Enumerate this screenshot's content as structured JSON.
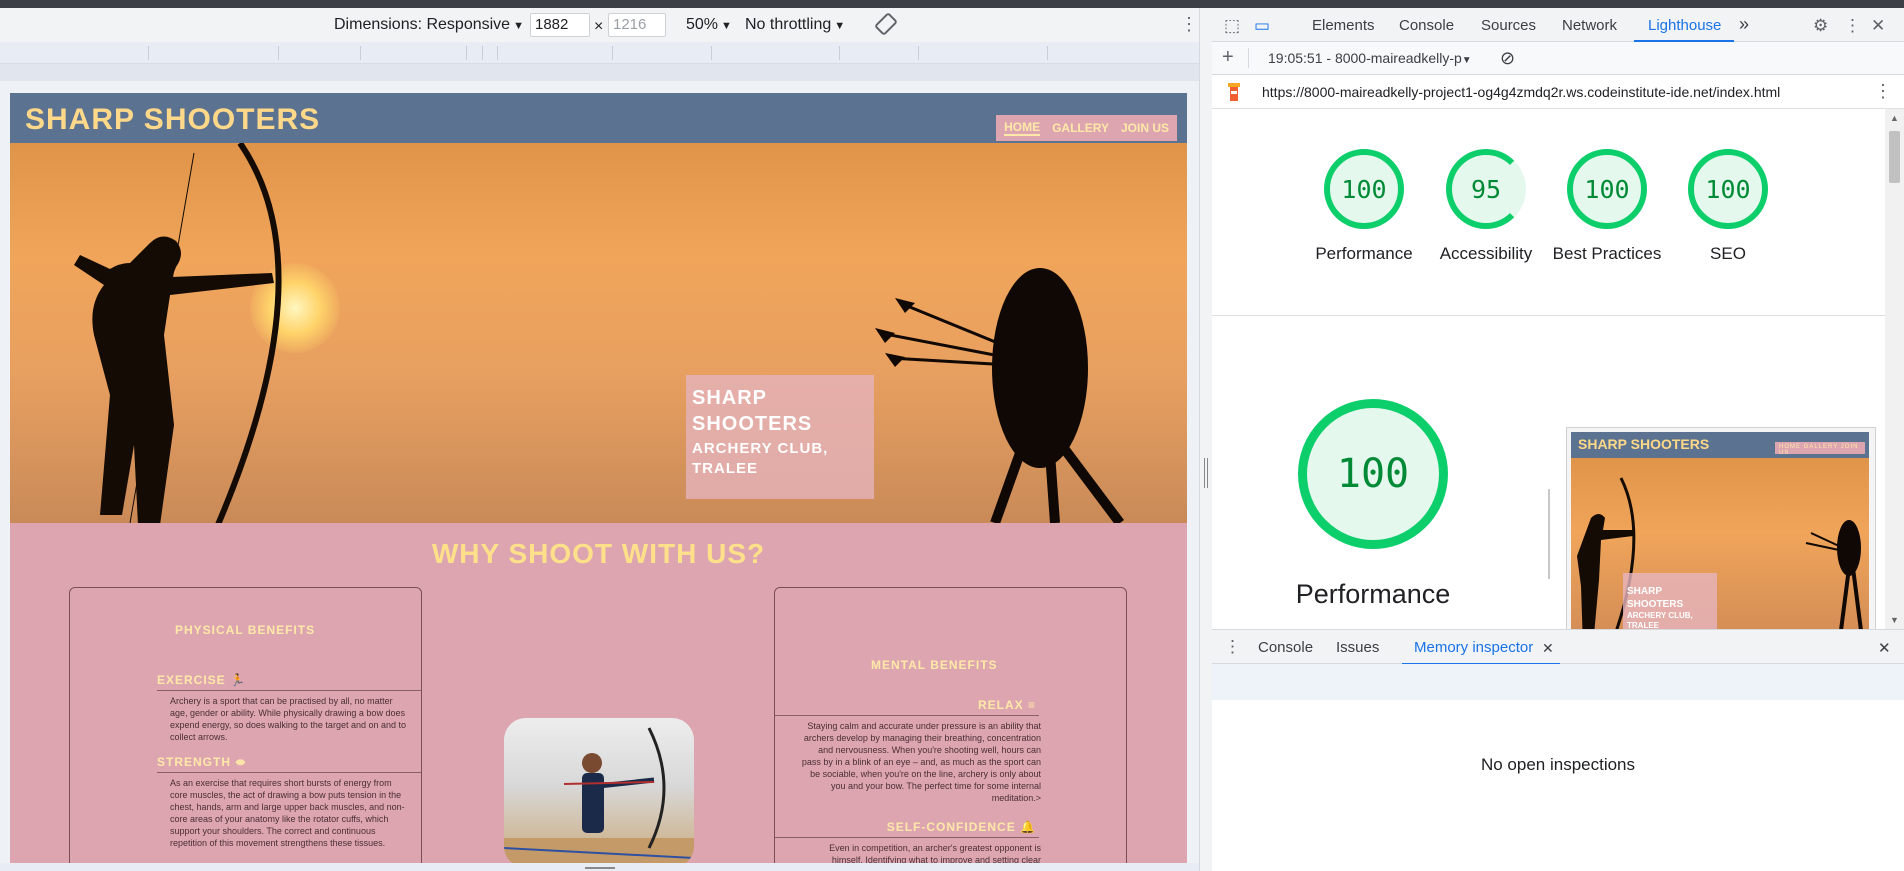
{
  "device_toolbar": {
    "dimensions_label": "Dimensions: Responsive",
    "width_value": "1882",
    "times_sign": "×",
    "height_value": "1216",
    "zoom": "50%",
    "throttling": "No throttling"
  },
  "site": {
    "logo": "SHARP SHOOTERS",
    "nav": [
      "HOME",
      "GALLERY",
      "JOIN US"
    ],
    "hero_card_title": "SHARP SHOOTERS",
    "hero_card_subtitle": "ARCHERY CLUB, TRALEE",
    "section_title": "WHY SHOOT WITH US?",
    "left_card": {
      "title": "PHYSICAL BENEFITS",
      "items": [
        {
          "heading": "EXERCISE",
          "icon": "running-person-icon",
          "text": "Archery is a sport that can be practised by all, no matter age, gender or ability. While physically drawing a bow does expend energy, so does walking to the target and on and to collect arrows."
        },
        {
          "heading": "STRENGTH",
          "icon": "dumbbell-icon",
          "text": "As an exercise that requires short bursts of energy from core muscles, the act of drawing a bow puts tension in the chest, hands, arm and large upper back muscles, and non-core areas of your anatomy like the rotator cuffs, which support your shoulders. The correct and continuous repetition of this movement strengthens these tissues."
        }
      ]
    },
    "right_card": {
      "title": "MENTAL BENEFITS",
      "items": [
        {
          "heading": "RELAX",
          "icon": "bars-icon",
          "text": "Staying calm and accurate under pressure is an ability that archers develop by managing their breathing, concentration and nervousness. When you're shooting well, hours can pass by in a blink of an eye – and, as much as the sport can be sociable, when you're on the line, archery is only about you and your bow. The perfect time for some internal meditation.>"
        },
        {
          "heading": "SELF-CONFIDENCE",
          "icon": "bell-icon",
          "text": "Even in competition, an archer's greatest opponent is himself. Identifying what to improve and setting clear"
        }
      ]
    }
  },
  "devtools": {
    "tabs": [
      "Elements",
      "Console",
      "Sources",
      "Network",
      "Lighthouse"
    ],
    "active_tab": "Lighthouse",
    "more_tabs": "»",
    "report_select": "19:05:51 - 8000-maireadkelly-p",
    "url": "https://8000-maireadkelly-project1-og4g4zmdq2r.ws.codeinstitute-ide.net/index.html",
    "scores": [
      {
        "label": "Performance",
        "value": "100"
      },
      {
        "label": "Accessibility",
        "value": "95"
      },
      {
        "label": "Best Practices",
        "value": "100"
      },
      {
        "label": "SEO",
        "value": "100"
      }
    ],
    "main_score": "100",
    "main_label": "Performance",
    "thumb_logo": "SHARP SHOOTERS",
    "thumb_menu": "HOME  GALLERY  JOIN US",
    "thumb_card_title": "SHARP SHOOTERS",
    "thumb_card_subtitle": "ARCHERY CLUB, TRALEE",
    "drawer_tabs": [
      "Console",
      "Issues",
      "Memory inspector"
    ],
    "drawer_active": "Memory inspector",
    "close_glyph": "✕",
    "drawer_empty": "No open inspections"
  },
  "colors": {
    "site_nav": "#5b7390",
    "site_body": "#dda5b0",
    "accent_yellow": "#ffe08a",
    "lighthouse_green": "#0cce6b",
    "devtools_blue": "#1a73e8"
  }
}
